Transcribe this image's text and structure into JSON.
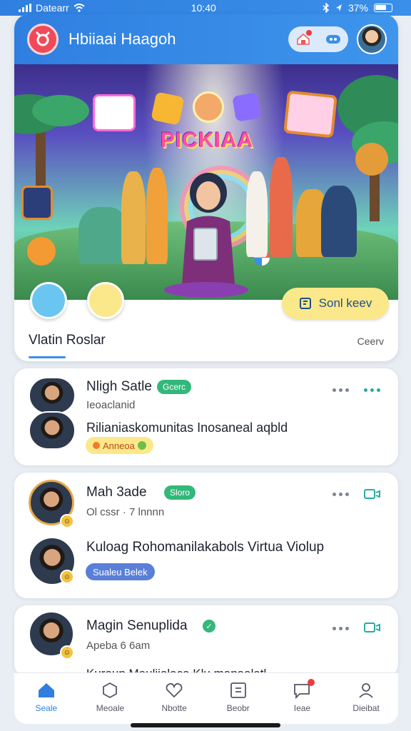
{
  "status_bar": {
    "carrier": "Datearr",
    "time": "10:40",
    "battery": "37%"
  },
  "header": {
    "title": "Hbiiaai Haagoh"
  },
  "hero": {
    "banner_text": "PICKIAA",
    "cta_label": "Sonl keev"
  },
  "tabs": {
    "active_label": "Vlatin Roslar",
    "right_label": "Ceerv"
  },
  "posts": [
    {
      "name": "Nligh Satle",
      "tag": "Gcerc",
      "subtitle": "Ieoaclanid",
      "body": "Rilianiaskomunitas Inosaneal aqbld",
      "chip": "Anneoa"
    },
    {
      "name": "Mah 3ade",
      "tag": "Sloro",
      "subtitle": "Ol cssr · 7 lnnnn",
      "body": "Kuloag Rohomanilakabols Virtua Violup",
      "chip": "Sualeu Belek"
    },
    {
      "name": "Magin Senuplida",
      "subtitle": "Apeba 6 6am",
      "body": "Kuraun Mauliialaca Klu manaalatl"
    }
  ],
  "bottom_nav": {
    "items": [
      {
        "label": "Seale",
        "icon": "home-icon"
      },
      {
        "label": "Meoale",
        "icon": "cube-icon"
      },
      {
        "label": "Nbotte",
        "icon": "heart-icon"
      },
      {
        "label": "Beobr",
        "icon": "grid-icon"
      },
      {
        "label": "Ieae",
        "icon": "chat-icon"
      },
      {
        "label": "Dieibat",
        "icon": "profile-icon"
      }
    ]
  },
  "colors": {
    "brand_blue": "#2f7fe0",
    "tag_green": "#33b87a",
    "cta_yellow": "#fbe88a",
    "alert_red": "#ef3b3b"
  }
}
